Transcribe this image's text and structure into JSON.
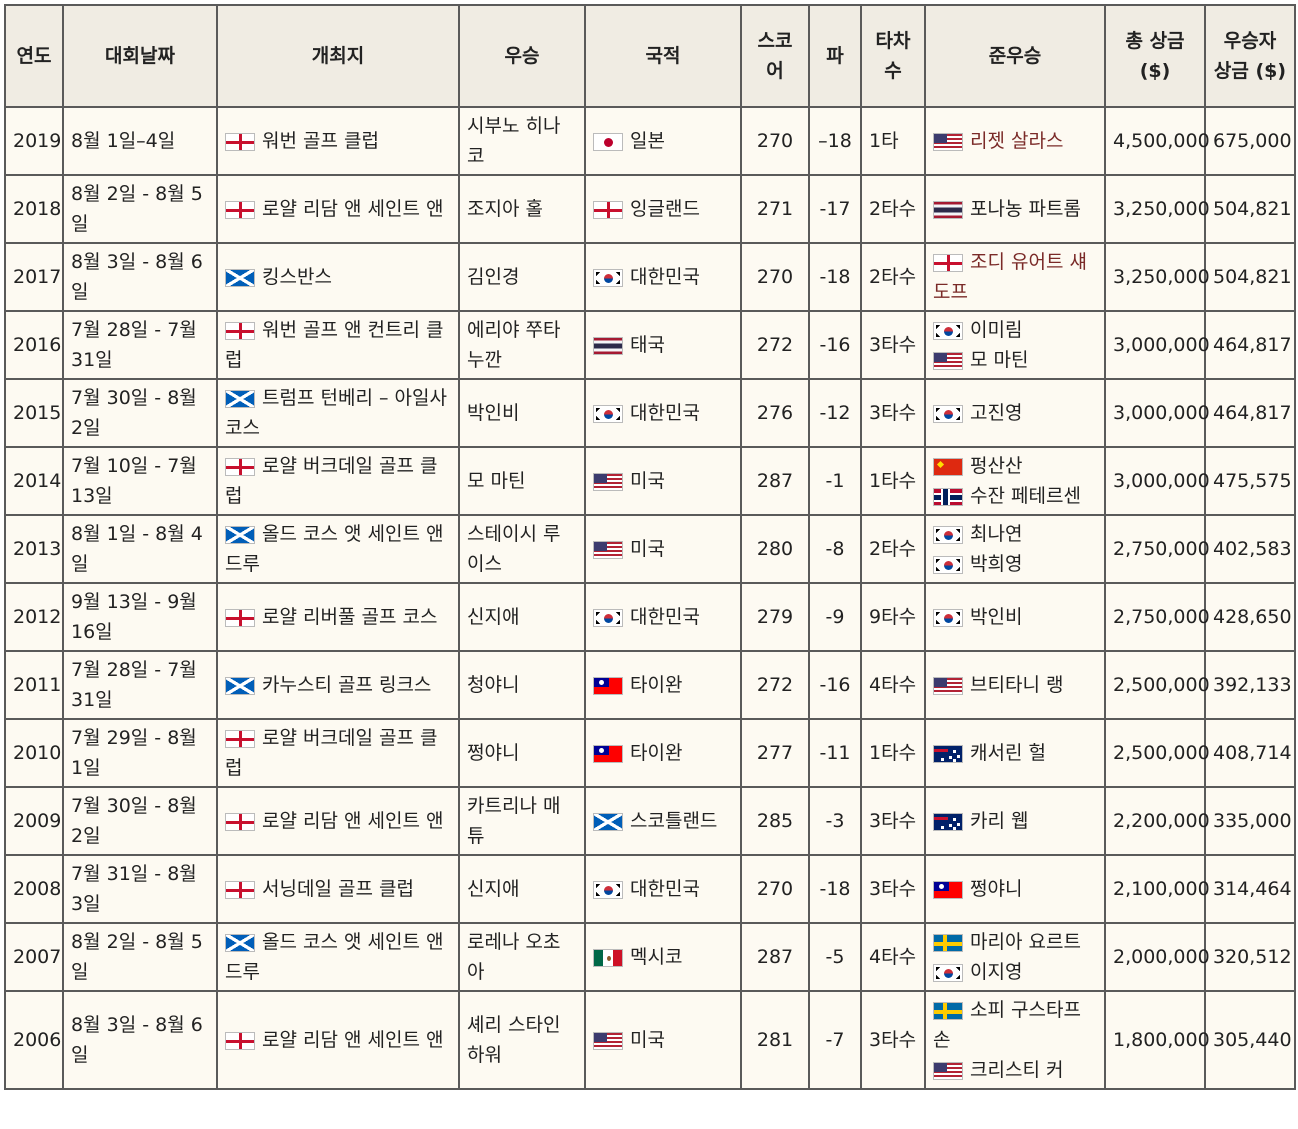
{
  "headers": {
    "year": "연도",
    "date": "대회날짜",
    "venue": "개최지",
    "winner": "우승",
    "nation": "국적",
    "score": "스코어",
    "par": "파",
    "margin": "타차수",
    "runnerup": "준우승",
    "purse": "총 상금 ($)",
    "share": "우승자 상금 ($)"
  },
  "rows": [
    {
      "year": "2019",
      "date": "8월 1일–4일",
      "venue_flag": "england",
      "venue": "워번 골프 클럽",
      "winner": "시부노 히나코",
      "nation_flag": "japan",
      "nation": "일본",
      "score": "270",
      "par": "–18",
      "margin": "1타",
      "runners": [
        {
          "flag": "usa",
          "name": "리젯 살라스",
          "link": true
        }
      ],
      "purse": "4,500,000",
      "share": "675,000"
    },
    {
      "year": "2018",
      "date": "8월 2일 - 8월 5일",
      "venue_flag": "england",
      "venue": "로얄 리담 앤 세인트 앤",
      "winner": "조지아 홀",
      "nation_flag": "england",
      "nation": "잉글랜드",
      "score": "271",
      "par": "-17",
      "margin": "2타수",
      "runners": [
        {
          "flag": "thailand",
          "name": "포나농 파트롬",
          "link": false
        }
      ],
      "purse": "3,250,000",
      "share": "504,821"
    },
    {
      "year": "2017",
      "date": "8월 3일 - 8월 6일",
      "venue_flag": "scotland",
      "venue": "킹스반스",
      "winner": "김인경",
      "nation_flag": "korea",
      "nation": "대한민국",
      "score": "270",
      "par": "-18",
      "margin": "2타수",
      "runners": [
        {
          "flag": "england",
          "name": "조디 유어트 섀도프",
          "link": true
        }
      ],
      "purse": "3,250,000",
      "share": "504,821"
    },
    {
      "year": "2016",
      "date": "7월 28일 - 7월 31일",
      "venue_flag": "england",
      "venue": "워번 골프 앤 컨트리 클럽",
      "winner": "에리야 쭈타누깐",
      "nation_flag": "thailand",
      "nation": "태국",
      "score": "272",
      "par": "-16",
      "margin": "3타수",
      "runners": [
        {
          "flag": "korea",
          "name": "이미림",
          "link": false
        },
        {
          "flag": "usa",
          "name": "모 마틴",
          "link": false
        }
      ],
      "purse": "3,000,000",
      "share": "464,817"
    },
    {
      "year": "2015",
      "date": "7월 30일 - 8월 2일",
      "venue_flag": "scotland",
      "venue": "트럼프 턴베리 – 아일사 코스",
      "winner": "박인비",
      "nation_flag": "korea",
      "nation": "대한민국",
      "score": "276",
      "par": "-12",
      "margin": "3타수",
      "runners": [
        {
          "flag": "korea",
          "name": "고진영",
          "link": false
        }
      ],
      "purse": "3,000,000",
      "share": "464,817"
    },
    {
      "year": "2014",
      "date": "7월 10일 - 7월 13일",
      "venue_flag": "england",
      "venue": "로얄 버크데일 골프 클럽",
      "winner": "모 마틴",
      "nation_flag": "usa",
      "nation": "미국",
      "score": "287",
      "par": "-1",
      "margin": "1타수",
      "runners": [
        {
          "flag": "china",
          "name": "펑산산",
          "link": false
        },
        {
          "flag": "norway",
          "name": "수잔 페테르센",
          "link": false
        }
      ],
      "purse": "3,000,000",
      "share": "475,575"
    },
    {
      "year": "2013",
      "date": "8월 1일 - 8월 4일",
      "venue_flag": "scotland",
      "venue": "올드 코스 앳 세인트 앤드루",
      "winner": "스테이시 루이스",
      "nation_flag": "usa",
      "nation": "미국",
      "score": "280",
      "par": "-8",
      "margin": "2타수",
      "runners": [
        {
          "flag": "korea",
          "name": "최나연",
          "link": false
        },
        {
          "flag": "korea",
          "name": "박희영",
          "link": false
        }
      ],
      "purse": "2,750,000",
      "share": "402,583"
    },
    {
      "year": "2012",
      "date": "9월 13일 - 9월 16일",
      "venue_flag": "england",
      "venue": "로얄 리버풀 골프 코스",
      "winner": "신지애",
      "nation_flag": "korea",
      "nation": "대한민국",
      "score": "279",
      "par": "-9",
      "margin": "9타수",
      "runners": [
        {
          "flag": "korea",
          "name": "박인비",
          "link": false
        }
      ],
      "purse": "2,750,000",
      "share": "428,650"
    },
    {
      "year": "2011",
      "date": "7월 28일 - 7월 31일",
      "venue_flag": "scotland",
      "venue": "카누스티 골프 링크스",
      "winner": "청야니",
      "nation_flag": "taiwan",
      "nation": "타이완",
      "score": "272",
      "par": "-16",
      "margin": "4타수",
      "runners": [
        {
          "flag": "usa",
          "name": "브티타니 랭",
          "link": false
        }
      ],
      "purse": "2,500,000",
      "share": "392,133"
    },
    {
      "year": "2010",
      "date": "7월 29일 - 8월 1일",
      "venue_flag": "england",
      "venue": "로얄 버크데일 골프 클럽",
      "winner": "쩡야니",
      "nation_flag": "taiwan",
      "nation": "타이완",
      "score": "277",
      "par": "-11",
      "margin": "1타수",
      "runners": [
        {
          "flag": "australia",
          "name": "캐서린 헐",
          "link": false
        }
      ],
      "purse": "2,500,000",
      "share": "408,714"
    },
    {
      "year": "2009",
      "date": "7월 30일 - 8월 2일",
      "venue_flag": "england",
      "venue": "로얄 리담 앤 세인트 앤",
      "winner": "카트리나 매튜",
      "nation_flag": "scotland",
      "nation": "스코틀랜드",
      "score": "285",
      "par": "-3",
      "margin": "3타수",
      "runners": [
        {
          "flag": "australia",
          "name": "카리 웹",
          "link": false
        }
      ],
      "purse": "2,200,000",
      "share": "335,000"
    },
    {
      "year": "2008",
      "date": "7월 31일 - 8월 3일",
      "venue_flag": "england",
      "venue": "서닝데일 골프 클럽",
      "winner": "신지애",
      "nation_flag": "korea",
      "nation": "대한민국",
      "score": "270",
      "par": "-18",
      "margin": "3타수",
      "runners": [
        {
          "flag": "taiwan",
          "name": "쩡야니",
          "link": false
        }
      ],
      "purse": "2,100,000",
      "share": "314,464"
    },
    {
      "year": "2007",
      "date": "8월 2일 - 8월 5일",
      "venue_flag": "scotland",
      "venue": "올드 코스 앳 세인트 앤드루",
      "winner": "로레나 오초아",
      "nation_flag": "mexico",
      "nation": "멕시코",
      "score": "287",
      "par": "-5",
      "margin": "4타수",
      "runners": [
        {
          "flag": "sweden",
          "name": "마리아 요르트",
          "link": false
        },
        {
          "flag": "korea",
          "name": "이지영",
          "link": false
        }
      ],
      "purse": "2,000,000",
      "share": "320,512"
    },
    {
      "year": "2006",
      "date": "8월 3일 - 8월 6일",
      "venue_flag": "england",
      "venue": "로얄 리담 앤 세인트 앤",
      "winner": "셰리 스타인하워",
      "nation_flag": "usa",
      "nation": "미국",
      "score": "281",
      "par": "-7",
      "margin": "3타수",
      "runners": [
        {
          "flag": "sweden",
          "name": "소피 구스타프손",
          "link": false
        },
        {
          "flag": "usa",
          "name": "크리스티 커",
          "link": false
        }
      ],
      "purse": "1,800,000",
      "share": "305,440"
    }
  ]
}
